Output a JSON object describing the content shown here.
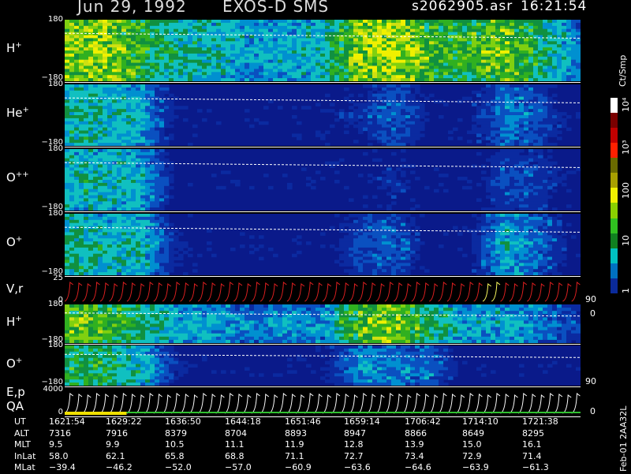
{
  "header": {
    "date": "Jun 29, 1992",
    "mission": "EXOS-D SMS",
    "file": "s2062905.asr",
    "time": "16:21:54"
  },
  "panels": [
    {
      "label_main": "H",
      "label_sup": "+",
      "ymax": "180",
      "ymin": "−180"
    },
    {
      "label_main": "He",
      "label_sup": "+",
      "ymax": "180",
      "ymin": "−180"
    },
    {
      "label_main": "O",
      "label_sup": "++",
      "ymax": "180",
      "ymin": "−180"
    },
    {
      "label_main": "O",
      "label_sup": "+",
      "ymax": "180",
      "ymin": "−180"
    },
    {
      "label_main": "V,r",
      "label_sup": "",
      "ymax": "25",
      "ymin": "0",
      "right_max": "90",
      "right_min": "0"
    },
    {
      "label_main": "H",
      "label_sup": "+",
      "ymax": "180",
      "ymin": "−180"
    },
    {
      "label_main": "O",
      "label_sup": "+",
      "ymax": "180",
      "ymin": "−180",
      "right_max": "90"
    },
    {
      "label_main": "E,p",
      "label_line2": "QA",
      "ymax": "4000",
      "ymin": "0",
      "right_min": "0"
    }
  ],
  "colorbar": {
    "unit": "Ct/Smp",
    "ticks": [
      "10⁴",
      "10³",
      "100",
      "10",
      "1"
    ],
    "colors": [
      "#ffffff",
      "#7a0000",
      "#c00000",
      "#ff2000",
      "#6a6a00",
      "#a8a000",
      "#f0f000",
      "#8ad000",
      "#30c020",
      "#108020",
      "#00c0c0",
      "#0070c0",
      "#0a2a9a"
    ]
  },
  "footer": {
    "row_labels": [
      "UT",
      "ALT",
      "MLT",
      "InLat",
      "MLat"
    ],
    "columns": [
      [
        "1621:54",
        "7316",
        "9.5",
        "58.0",
        "−39.4"
      ],
      [
        "1629:22",
        "7916",
        "9.9",
        "62.1",
        "−46.2"
      ],
      [
        "1636:50",
        "8379",
        "10.5",
        "65.8",
        "−52.0"
      ],
      [
        "1644:18",
        "8704",
        "11.1",
        "68.8",
        "−57.0"
      ],
      [
        "1651:46",
        "8893",
        "11.9",
        "71.1",
        "−60.9"
      ],
      [
        "1659:14",
        "8947",
        "12.8",
        "72.7",
        "−63.6"
      ],
      [
        "1706:42",
        "8866",
        "13.9",
        "73.4",
        "−64.6"
      ],
      [
        "1714:10",
        "8649",
        "15.0",
        "72.9",
        "−63.9"
      ],
      [
        "1721:38",
        "8295",
        "16.1",
        "71.4",
        "−61.3"
      ]
    ],
    "side_text": "Feb-01 2AA32L"
  },
  "chart_data": {
    "type": "heatmap",
    "title": "Jun 29, 1992   EXOS-D SMS",
    "x": [
      "1621:54",
      "1629:22",
      "1636:50",
      "1644:18",
      "1651:46",
      "1659:14",
      "1706:42",
      "1714:10",
      "1721:38"
    ],
    "series": [
      {
        "name": "H+",
        "ylim": [
          -180,
          180
        ],
        "intensity": [
          0.85,
          0.9,
          0.7,
          0.55,
          0.5,
          0.4,
          0.45,
          0.5,
          0.85,
          0.95,
          0.75,
          0.7,
          0.85,
          0.6,
          0.35
        ]
      },
      {
        "name": "He+",
        "ylim": [
          -180,
          180
        ],
        "intensity": [
          0.55,
          0.5,
          0.45,
          0.1,
          0.05,
          0.05,
          0.05,
          0.1,
          0.15,
          0.3,
          0.1,
          0.1,
          0.35,
          0.25,
          0.05
        ]
      },
      {
        "name": "O++",
        "ylim": [
          -180,
          180
        ],
        "intensity": [
          0.5,
          0.5,
          0.45,
          0.1,
          0.05,
          0.05,
          0.05,
          0.05,
          0.1,
          0.15,
          0.05,
          0.05,
          0.25,
          0.2,
          0.05
        ]
      },
      {
        "name": "O+",
        "ylim": [
          -180,
          180
        ],
        "intensity": [
          0.55,
          0.5,
          0.5,
          0.15,
          0.05,
          0.05,
          0.05,
          0.05,
          0.25,
          0.3,
          0.05,
          0.1,
          0.45,
          0.3,
          0.05
        ]
      },
      {
        "name": "H+",
        "ylim": [
          -180,
          180
        ],
        "intensity": [
          0.8,
          0.75,
          0.6,
          0.45,
          0.4,
          0.35,
          0.4,
          0.35,
          0.8,
          0.85,
          0.6,
          0.4,
          0.45,
          0.35,
          0.2
        ]
      },
      {
        "name": "O+",
        "ylim": [
          -180,
          180
        ],
        "intensity": [
          0.7,
          0.65,
          0.5,
          0.15,
          0.05,
          0.05,
          0.05,
          0.1,
          0.4,
          0.35,
          0.3,
          0.05,
          0.05,
          0.05,
          0.05
        ]
      }
    ],
    "line_panels": [
      {
        "name": "V,r",
        "ylim": [
          0,
          25
        ]
      },
      {
        "name": "E,p QA",
        "ylim": [
          0,
          4000
        ]
      }
    ]
  }
}
